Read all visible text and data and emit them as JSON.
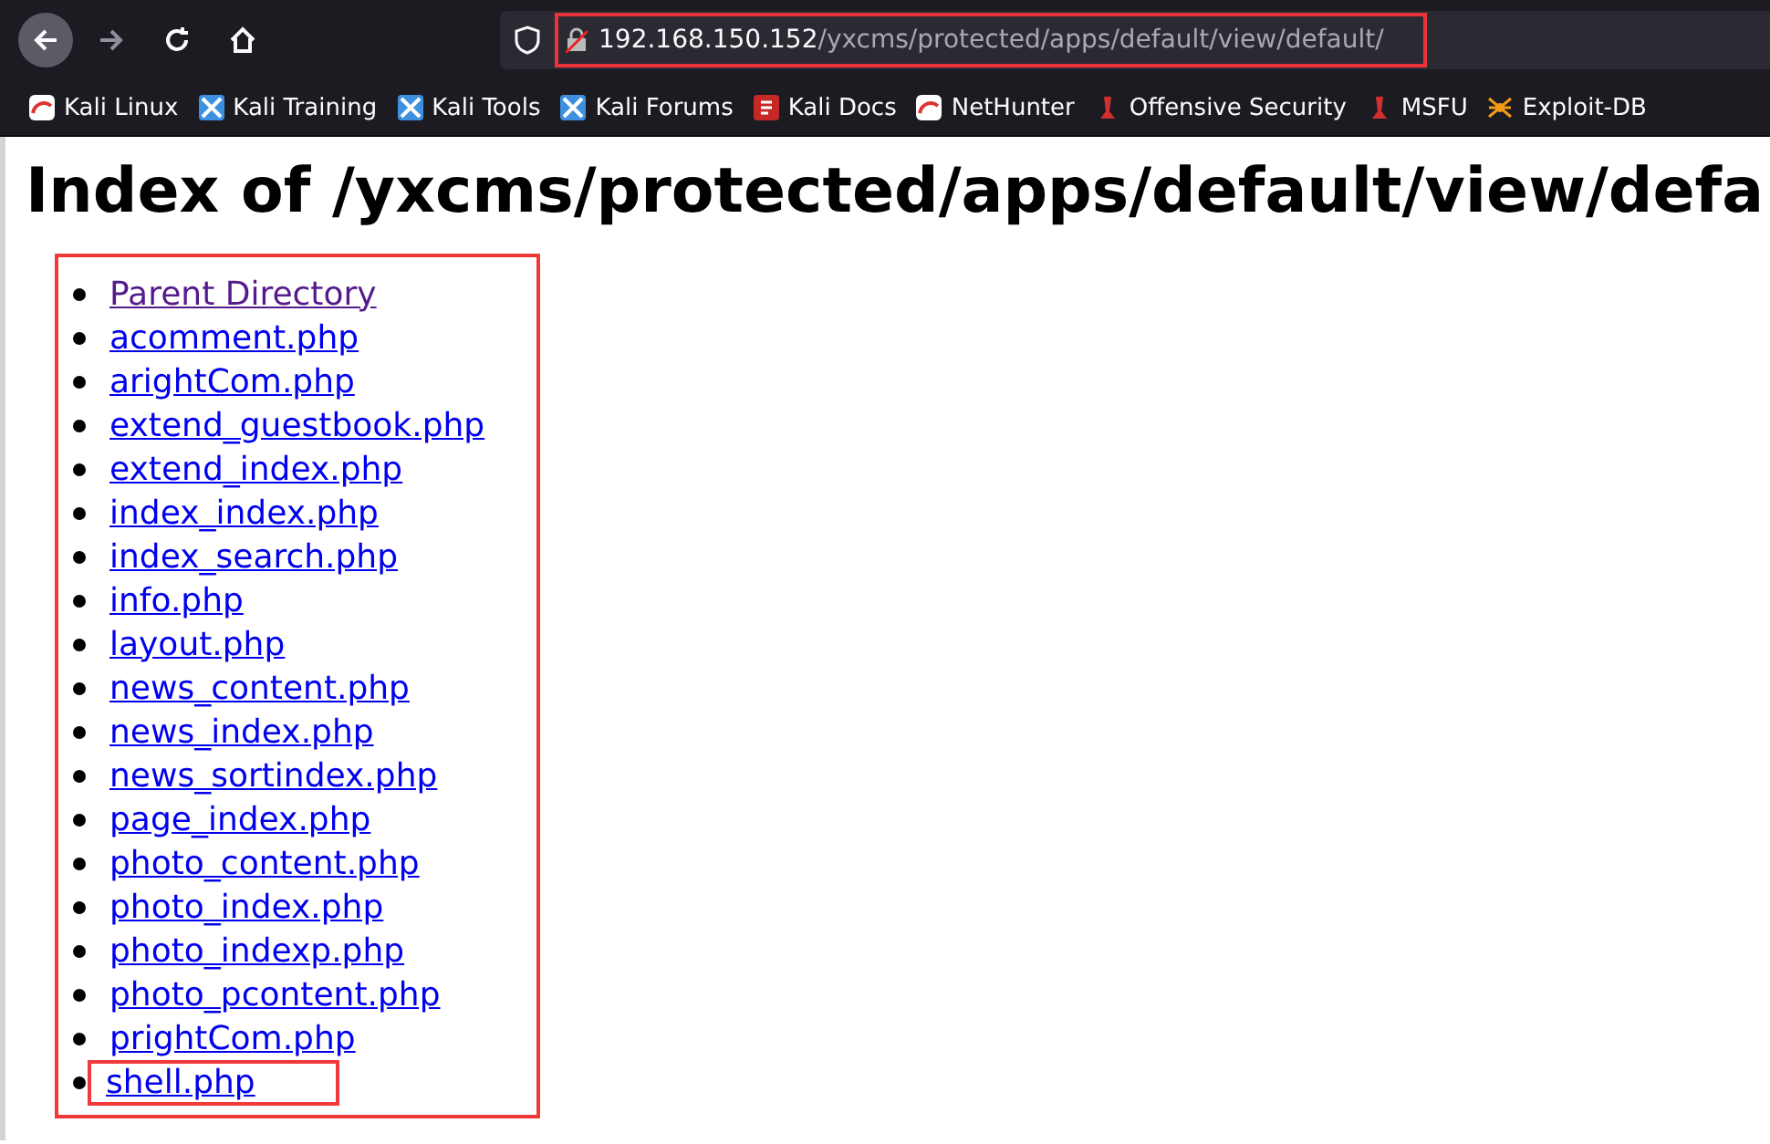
{
  "toolbar": {
    "url_host": "192.168.150.152",
    "url_path": "/yxcms/protected/apps/default/view/default/",
    "url_highlighted": true
  },
  "bookmarks": [
    {
      "label": "Kali Linux",
      "kind": "kali"
    },
    {
      "label": "Kali Training",
      "kind": "blue"
    },
    {
      "label": "Kali Tools",
      "kind": "blue"
    },
    {
      "label": "Kali Forums",
      "kind": "blue"
    },
    {
      "label": "Kali Docs",
      "kind": "docs"
    },
    {
      "label": "NetHunter",
      "kind": "kali"
    },
    {
      "label": "Offensive Security",
      "kind": "red"
    },
    {
      "label": "MSFU",
      "kind": "red"
    },
    {
      "label": "Exploit-DB",
      "kind": "spider"
    }
  ],
  "heading": "Index of /yxcms/protected/apps/default/view/defa",
  "listing": {
    "highlighted": true,
    "items": [
      {
        "label": "Parent Directory",
        "visited": true,
        "highlighted": false
      },
      {
        "label": "acomment.php",
        "visited": false,
        "highlighted": false
      },
      {
        "label": "arightCom.php",
        "visited": false,
        "highlighted": false
      },
      {
        "label": "extend_guestbook.php",
        "visited": false,
        "highlighted": false
      },
      {
        "label": "extend_index.php",
        "visited": false,
        "highlighted": false
      },
      {
        "label": "index_index.php",
        "visited": false,
        "highlighted": false
      },
      {
        "label": "index_search.php",
        "visited": false,
        "highlighted": false
      },
      {
        "label": "info.php",
        "visited": false,
        "highlighted": false
      },
      {
        "label": "layout.php",
        "visited": false,
        "highlighted": false
      },
      {
        "label": "news_content.php",
        "visited": false,
        "highlighted": false
      },
      {
        "label": "news_index.php",
        "visited": false,
        "highlighted": false
      },
      {
        "label": "news_sortindex.php",
        "visited": false,
        "highlighted": false
      },
      {
        "label": "page_index.php",
        "visited": false,
        "highlighted": false
      },
      {
        "label": "photo_content.php",
        "visited": false,
        "highlighted": false
      },
      {
        "label": "photo_index.php",
        "visited": false,
        "highlighted": false
      },
      {
        "label": "photo_indexp.php",
        "visited": false,
        "highlighted": false
      },
      {
        "label": "photo_pcontent.php",
        "visited": false,
        "highlighted": false
      },
      {
        "label": "prightCom.php",
        "visited": false,
        "highlighted": false
      },
      {
        "label": "shell.php",
        "visited": false,
        "highlighted": true
      }
    ]
  }
}
